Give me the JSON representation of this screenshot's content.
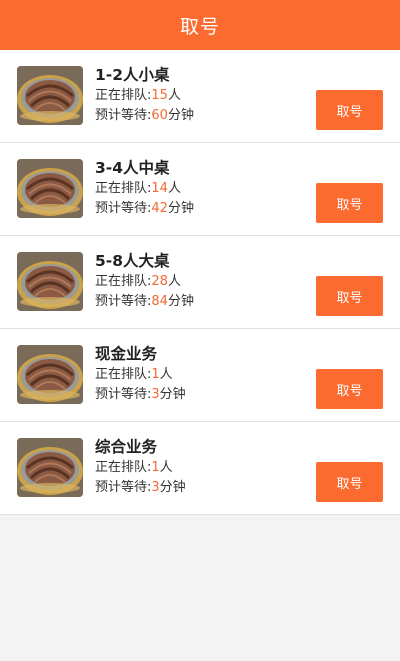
{
  "header": {
    "title": "取号"
  },
  "labels": {
    "queue_prefix": "正在排队:",
    "queue_unit": "人",
    "wait_prefix": "预计等待:",
    "wait_unit": "分钟",
    "button": "取号"
  },
  "items": [
    {
      "name": "1-2人小桌",
      "queue": "15",
      "wait": "60",
      "thumb": "grilled-meat-icon"
    },
    {
      "name": "3-4人中桌",
      "queue": "14",
      "wait": "42",
      "thumb": "grilled-meat-icon"
    },
    {
      "name": "5-8人大桌",
      "queue": "28",
      "wait": "84",
      "thumb": "grilled-meat-icon"
    },
    {
      "name": "现金业务",
      "queue": "1",
      "wait": "3",
      "thumb": "grilled-meat-icon"
    },
    {
      "name": "综合业务",
      "queue": "1",
      "wait": "3",
      "thumb": "grilled-meat-icon"
    }
  ],
  "colors": {
    "accent": "#fb6a2f",
    "highlight_number": "#f26a32"
  }
}
